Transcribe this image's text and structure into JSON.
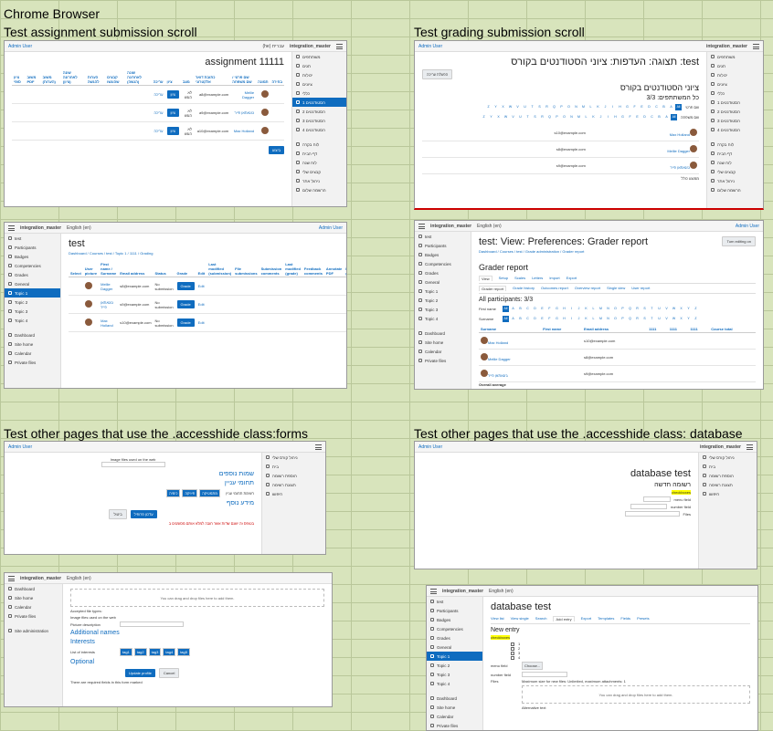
{
  "page": {
    "title": "Chrome Browser"
  },
  "sections": {
    "assign_scroll": "Test assignment submission scroll",
    "grading_scroll": "Test grading submission scroll",
    "forms": "Test other pages that use the .accesshide class:forms",
    "database": "Test other pages that use the .accesshide class: database"
  },
  "common": {
    "site": "integration_master",
    "user": "Admin User",
    "lang": "English (en)",
    "lang_he": "עברית (he)"
  },
  "s1": {
    "title": "assignment 11111",
    "nav": [
      "משתתפים",
      "תגים",
      "יכולות",
      "ציונים",
      "כללי",
      "הסטודנטים 1",
      "הסטודנטים 2",
      "הסטודנטים 3",
      "הסטודנטים 4",
      "לוח בקרה",
      "דף הבית",
      "לוח שנה",
      "קבצים שלי",
      "ניהול אתר",
      "הרשמה שלום"
    ],
    "headers": [
      "בחירה",
      "תמונה",
      "שם פרטי / שם משפחה",
      "כתובת דואר אלקטרוני",
      "מצב",
      "ציון",
      "עריכה",
      "שונה לאחרונה (הגשה)",
      "קבצים שהוגשו",
      "הערות להגשה",
      "שונה לאחרונה (ציון)",
      "משוב (הערות)",
      "משוב PDF",
      "ציון סופי"
    ],
    "rows": [
      {
        "name": "Mellie Dagger",
        "email": "a8@example.com",
        "status": "לא הוגש",
        "grade": "ציון",
        "edit": "עריכה"
      },
      {
        "name": "ג'ונאתאן פייר",
        "email": "a9@example.com",
        "status": "לא הוגש",
        "grade": "ציון",
        "edit": "עריכה"
      },
      {
        "name": "Max Holland",
        "email": "a10@example.com",
        "status": "לא הוגש",
        "grade": "ציון",
        "edit": "עריכה"
      }
    ],
    "go": "ביצוע"
  },
  "s2": {
    "title": "test: תצוגה: העדפות: ציוני הסטודנטים בקורס",
    "h2": "ציוני הסטודנטים בקורס",
    "all": "כל המשתתפים: 3/3",
    "first": "שם פרטי",
    "last": "שם משפחה",
    "rows": [
      "Max Holland",
      "Mellie Dagger",
      "ג'ונאתאן פייר"
    ],
    "emails": [
      "s10@example.com",
      "s8@example.com",
      "s9@example.com"
    ],
    "turn_editing": "הפעלת עריכה",
    "avg": "ממוצע כולל"
  },
  "s3": {
    "title": "test",
    "crumb": "Dashboard / Courses / test / Topic 1 / 1111 / Grading",
    "nav": [
      "test",
      "Participants",
      "Badges",
      "Competencies",
      "Grades",
      "General",
      "Topic 1",
      "Topic 2",
      "Topic 3",
      "Topic 4",
      "Dashboard",
      "Site home",
      "Calendar",
      "Private files"
    ],
    "headers": [
      "Select",
      "User picture",
      "First name / Surname",
      "Email address",
      "Status",
      "Grade",
      "Edit",
      "Last modified (submission)",
      "File submissions",
      "Submission comments",
      "Last modified (grade)",
      "Feedback comments",
      "Annotate PDF",
      "Final grade"
    ],
    "rows": [
      {
        "name": "Mellie Dagger",
        "email": "s8@example.com",
        "status": "No submission",
        "grade": "Grade",
        "edit": "Edit"
      },
      {
        "name": "ג'ונאתאן פייר",
        "email": "s9@example.com",
        "status": "No submission",
        "grade": "Grade",
        "edit": "Edit"
      },
      {
        "name": "Max Holland",
        "email": "s10@example.com",
        "status": "No submission",
        "grade": "Grade",
        "edit": "Edit"
      }
    ]
  },
  "s4": {
    "title": "test: View: Preferences: Grader report",
    "crumb": "Dashboard / Courses / test / Grade administration / Grader report",
    "turn_editing": "Turn editing on",
    "h2": "Grader report",
    "tabs": [
      "View",
      "Setup",
      "Scales",
      "Letters",
      "Import",
      "Export"
    ],
    "subtabs": [
      "Grader report",
      "Grade history",
      "Outcomes report",
      "Overview report",
      "Single view",
      "User report"
    ],
    "all": "All participants: 3/3",
    "first": "First name",
    "surname": "Surname",
    "letters": [
      "All",
      "A",
      "B",
      "C",
      "D",
      "E",
      "F",
      "G",
      "H",
      "I",
      "J",
      "K",
      "L",
      "M",
      "N",
      "O",
      "P",
      "Q",
      "R",
      "S",
      "T",
      "U",
      "V",
      "W",
      "X",
      "Y",
      "Z"
    ],
    "nav": [
      "test",
      "Participants",
      "Badges",
      "Competencies",
      "Grades",
      "General",
      "Topic 1",
      "Topic 2",
      "Topic 3",
      "Topic 4",
      "Dashboard",
      "Site home",
      "Calendar",
      "Private files"
    ],
    "cols": [
      "Surname",
      "First name",
      "Email address",
      "1111",
      "1111",
      "1111",
      "Course total"
    ],
    "rows": [
      {
        "name": "Max Holland",
        "email": "s10@example.com"
      },
      {
        "name": "Mellie Dagger",
        "email": "s8@example.com"
      },
      {
        "name": "ג'ונאתאן פייר",
        "email": "s9@example.com"
      }
    ],
    "avg": "Overall average"
  },
  "s5": {
    "img_files": "Image files used on the web",
    "additional": "שמות נוספים",
    "interests": "תחומי עניין",
    "optional": "מידע נוסף",
    "list": "רשימת תחומי עניין",
    "tags": [
      "מתמטיקה",
      "פיזיקה",
      "כימיה"
    ],
    "update": "עדכון פרופיל",
    "cancel": "ביטול",
    "required": "בטופס זה ישנם שדות אשר חובה למלא אותם מסומנים ב"
  },
  "s6": {
    "title": "database test",
    "nav": [
      "ניהול קורס שלי",
      "בית",
      "הוספת רשומה",
      "תצוגת רשימה",
      "חיפוש"
    ],
    "entry": "רשומה חדשה",
    "checkboxes": "checkboxes",
    "menu": "menu field",
    "number": "number field",
    "files": "Files"
  },
  "s7": {
    "dropzone": "You can drag and drop files here to add them.",
    "accepted": "Accepted file types:",
    "img_files": "Image files used on the web",
    "pic_desc": "Picture description",
    "additional": "Additional names",
    "interests": "Interests",
    "list": "List of interests",
    "tags": [
      "tag1",
      "tag2",
      "tag3",
      "tag4",
      "tag5"
    ],
    "optional": "Optional",
    "update": "Update profile",
    "cancel": "Cancel",
    "required": "There are required fields in this form marked",
    "nav": [
      "Dashboard",
      "Site home",
      "Calendar",
      "Private files",
      "Site administration"
    ]
  },
  "s8": {
    "title": "database test",
    "tabs": [
      "View list",
      "View single",
      "Search",
      "Add entry",
      "Export",
      "Templates",
      "Fields",
      "Presets"
    ],
    "entry": "New entry",
    "checkboxes": "checkboxes",
    "options": [
      "1",
      "2",
      "3",
      "4"
    ],
    "menu": "menu field",
    "menu_val": "Choose...",
    "number": "number field",
    "files": "Files",
    "maxsize": "Maximum size for new files: Unlimited, maximum attachments: 1",
    "dropzone": "You can drag and drop files here to add them.",
    "alt": "Alternative text",
    "nav": [
      "test",
      "Participants",
      "Badges",
      "Competencies",
      "Grades",
      "General",
      "Topic 1",
      "Topic 2",
      "Topic 3",
      "Topic 4",
      "Dashboard",
      "Site home",
      "Calendar",
      "Private files"
    ]
  }
}
